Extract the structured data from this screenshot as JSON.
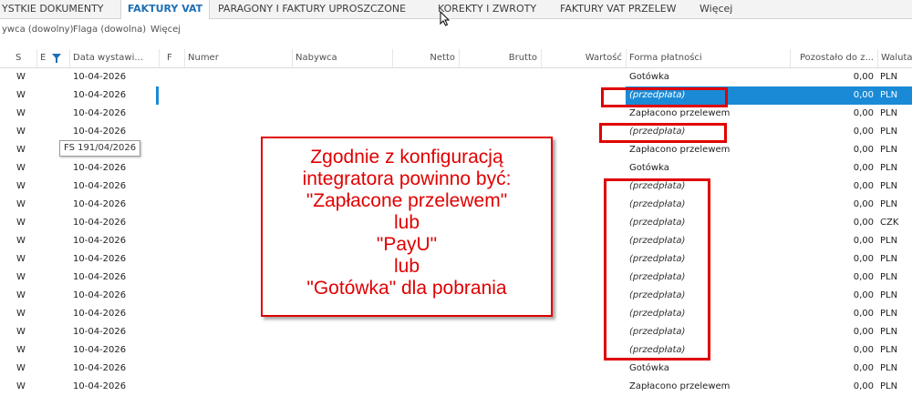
{
  "tabs": [
    {
      "label": "YSTKIE DOKUMENTY",
      "active": false
    },
    {
      "label": "FAKTURY VAT",
      "active": true
    },
    {
      "label": "PARAGONY I FAKTURY UPROSZCZONE",
      "active": false
    },
    {
      "label": "KOREKTY I ZWROTY",
      "active": false
    },
    {
      "label": "FAKTURY VAT PRZELEW",
      "active": false
    },
    {
      "label": "Więcej",
      "active": false
    }
  ],
  "filters": {
    "buyer": "ywca (dowolny)",
    "flag": "Flaga (dowolna)",
    "more": "Więcej"
  },
  "columns": {
    "s": "S",
    "e": "E",
    "date": "Data wystawi...",
    "f": "F",
    "number": "Numer",
    "buyer": "Nabywca",
    "net": "Netto",
    "gross": "Brutto",
    "value": "Wartość",
    "payment": "Forma płatności",
    "remaining": "Pozostało do z...",
    "currency": "Waluta"
  },
  "rows": [
    {
      "s": "W",
      "date": "10-04-2026",
      "payment": "Gotówka",
      "remaining": "0,00",
      "currency": "PLN",
      "prepaid": false,
      "selected": false
    },
    {
      "s": "W",
      "date": "10-04-2026",
      "payment": "(przedpłata)",
      "remaining": "0,00",
      "currency": "PLN",
      "prepaid": true,
      "selected": true
    },
    {
      "s": "W",
      "date": "10-04-2026",
      "payment": "Zapłacono przelewem",
      "remaining": "0,00",
      "currency": "PLN",
      "prepaid": false,
      "selected": false
    },
    {
      "s": "W",
      "date": "10-04-2026",
      "payment": "(przedpłata)",
      "remaining": "0,00",
      "currency": "PLN",
      "prepaid": true,
      "selected": false
    },
    {
      "s": "W",
      "date": "",
      "payment": "Zapłacono przelewem",
      "remaining": "0,00",
      "currency": "PLN",
      "prepaid": false,
      "selected": false
    },
    {
      "s": "W",
      "date": "10-04-2026",
      "payment": "Gotówka",
      "remaining": "0,00",
      "currency": "PLN",
      "prepaid": false,
      "selected": false
    },
    {
      "s": "W",
      "date": "10-04-2026",
      "payment": "(przedpłata)",
      "remaining": "0,00",
      "currency": "PLN",
      "prepaid": true,
      "selected": false
    },
    {
      "s": "W",
      "date": "10-04-2026",
      "payment": "(przedpłata)",
      "remaining": "0,00",
      "currency": "PLN",
      "prepaid": true,
      "selected": false
    },
    {
      "s": "W",
      "date": "10-04-2026",
      "payment": "(przedpłata)",
      "remaining": "0,00",
      "currency": "CZK",
      "prepaid": true,
      "selected": false
    },
    {
      "s": "W",
      "date": "10-04-2026",
      "payment": "(przedpłata)",
      "remaining": "0,00",
      "currency": "PLN",
      "prepaid": true,
      "selected": false
    },
    {
      "s": "W",
      "date": "10-04-2026",
      "payment": "(przedpłata)",
      "remaining": "0,00",
      "currency": "PLN",
      "prepaid": true,
      "selected": false
    },
    {
      "s": "W",
      "date": "10-04-2026",
      "payment": "(przedpłata)",
      "remaining": "0,00",
      "currency": "PLN",
      "prepaid": true,
      "selected": false
    },
    {
      "s": "W",
      "date": "10-04-2026",
      "payment": "(przedpłata)",
      "remaining": "0,00",
      "currency": "PLN",
      "prepaid": true,
      "selected": false
    },
    {
      "s": "W",
      "date": "10-04-2026",
      "payment": "(przedpłata)",
      "remaining": "0,00",
      "currency": "PLN",
      "prepaid": true,
      "selected": false
    },
    {
      "s": "W",
      "date": "10-04-2026",
      "payment": "(przedpłata)",
      "remaining": "0,00",
      "currency": "PLN",
      "prepaid": true,
      "selected": false
    },
    {
      "s": "W",
      "date": "10-04-2026",
      "payment": "(przedpłata)",
      "remaining": "0,00",
      "currency": "PLN",
      "prepaid": true,
      "selected": false
    },
    {
      "s": "W",
      "date": "10-04-2026",
      "payment": "Gotówka",
      "remaining": "0,00",
      "currency": "PLN",
      "prepaid": false,
      "selected": false
    },
    {
      "s": "W",
      "date": "10-04-2026",
      "payment": "Zapłacono przelewem",
      "remaining": "0,00",
      "currency": "PLN",
      "prepaid": false,
      "selected": false
    }
  ],
  "tooltip": "FS 191/04/2026",
  "annotation": {
    "lines": [
      "Zgodnie z konfiguracją",
      "integratora powinno być:",
      "\"Zapłacone przelewem\"",
      "lub",
      "\"PayU\"",
      "lub",
      "\"Gotówka\" dla pobrania"
    ]
  },
  "colors": {
    "accent": "#1e6fb3",
    "selection": "#1a8ad6",
    "annotation": "#e00000"
  },
  "icons": {
    "filter": "filter-icon",
    "cursor": "mouse-pointer-icon"
  }
}
